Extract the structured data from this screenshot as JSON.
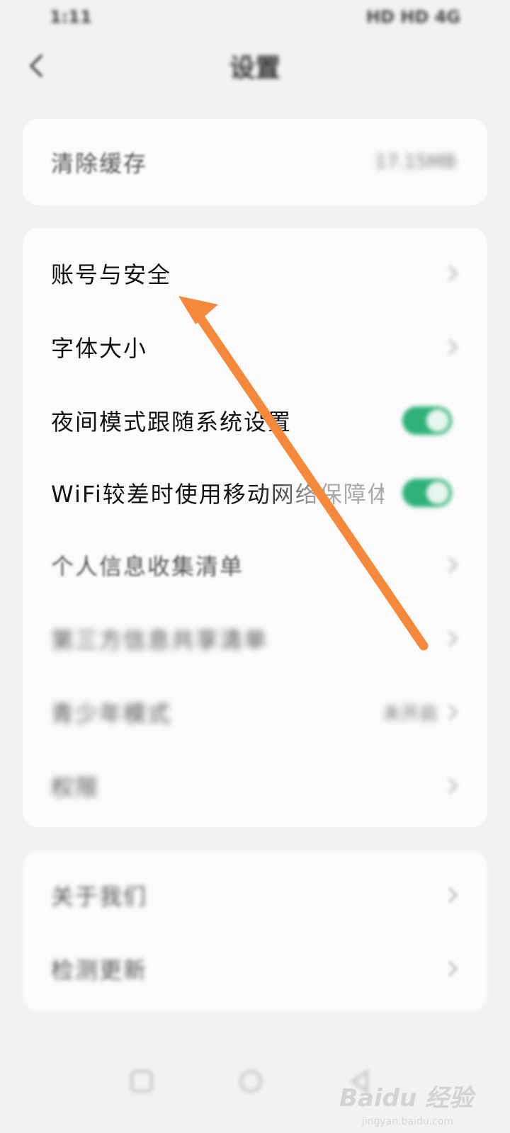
{
  "status_bar": {
    "time": "1:11",
    "right": "HD HD 4G"
  },
  "header": {
    "title": "设置"
  },
  "cache_card": {
    "label": "清除缓存",
    "value": "17.15MB"
  },
  "settings": [
    {
      "label": "账号与安全",
      "type": "chevron"
    },
    {
      "label": "字体大小",
      "type": "chevron"
    },
    {
      "label": "夜间模式跟随系统设置",
      "type": "toggle",
      "enabled": true
    },
    {
      "label": "WiFi较差时使用移动网络保障体验",
      "type": "toggle",
      "enabled": true
    },
    {
      "label": "个人信息收集清单",
      "type": "chevron"
    },
    {
      "label": "第三方信息共享清单",
      "type": "chevron"
    },
    {
      "label": "青少年模式",
      "type": "chevron",
      "value": "未开启"
    },
    {
      "label": "权限",
      "type": "chevron"
    }
  ],
  "about": [
    {
      "label": "关于我们",
      "type": "chevron"
    },
    {
      "label": "检测更新",
      "type": "chevron"
    }
  ],
  "watermark": {
    "brand": "Baidu 经验",
    "site": "jingyan.baidu.com"
  },
  "colors": {
    "toggle_on": "#2fb17a",
    "annotation_arrow": "#f5883a",
    "background": "#f2f2f2"
  }
}
